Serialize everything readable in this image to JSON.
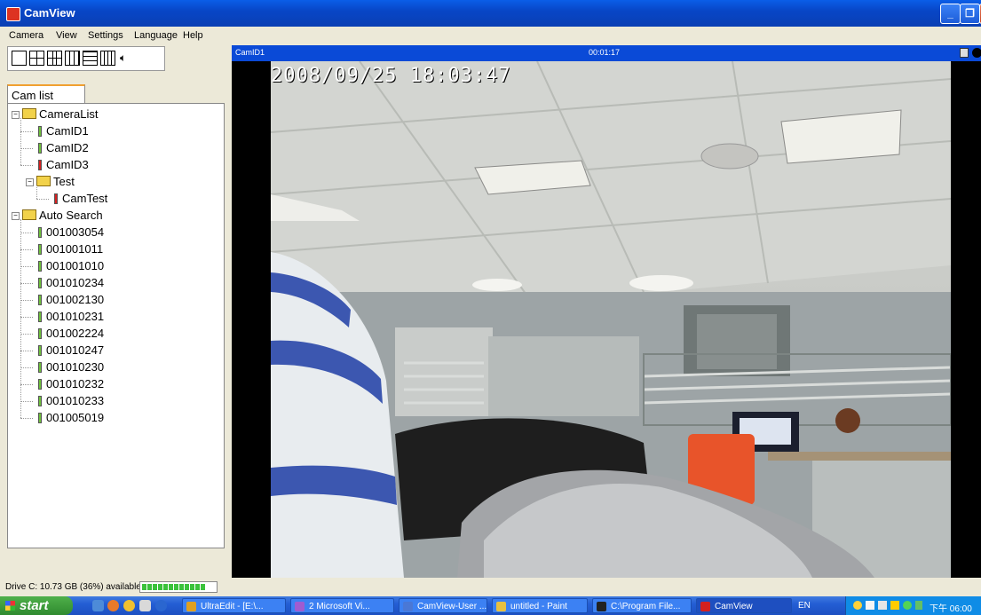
{
  "window": {
    "title": "CamView"
  },
  "menu": [
    "Camera",
    "View",
    "Settings",
    "Language",
    "Help"
  ],
  "sidebar": {
    "tab_label": "Cam list",
    "tree": [
      {
        "label": "CameraList",
        "kind": "folder",
        "children": [
          {
            "label": "CamID1",
            "status": "green"
          },
          {
            "label": "CamID2",
            "status": "green"
          },
          {
            "label": "CamID3",
            "status": "red"
          }
        ]
      },
      {
        "label": "Test",
        "kind": "folder",
        "children": [
          {
            "label": "CamTest",
            "status": "red"
          }
        ]
      },
      {
        "label": "Auto Search",
        "kind": "folder",
        "children": [
          {
            "label": "001003054",
            "status": "green"
          },
          {
            "label": "001001011",
            "status": "green"
          },
          {
            "label": "001001010",
            "status": "green"
          },
          {
            "label": "001010234",
            "status": "green"
          },
          {
            "label": "001002130",
            "status": "green"
          },
          {
            "label": "001010231",
            "status": "green"
          },
          {
            "label": "001002224",
            "status": "green"
          },
          {
            "label": "001010247",
            "status": "green"
          },
          {
            "label": "001010230",
            "status": "green"
          },
          {
            "label": "001010232",
            "status": "green"
          },
          {
            "label": "001010233",
            "status": "green"
          },
          {
            "label": "001005019",
            "status": "green"
          }
        ]
      }
    ]
  },
  "viewer": {
    "camera_name": "CamID1",
    "elapsed": "00:01:17",
    "overlay_timestamp": "2008/09/25 18:03:47"
  },
  "status": {
    "drive_text": "Drive C: 10.73 GB (36%) available",
    "drive_free_fraction": 0.36
  },
  "taskbar": {
    "start_label": "start",
    "tasks": [
      {
        "label": "UltraEdit - [E:\\...",
        "icon_color": "#e0a020"
      },
      {
        "label": "2 Microsoft Vi...",
        "icon_color": "#a05cd0"
      },
      {
        "label": "CamView-User ...",
        "icon_color": "#4a78d6"
      },
      {
        "label": "untitled - Paint",
        "icon_color": "#e8c040"
      },
      {
        "label": "C:\\Program File...",
        "icon_color": "#222222"
      },
      {
        "label": "CamView",
        "icon_color": "#d32020",
        "active": true
      }
    ],
    "language": "EN",
    "clock": "下午 06:00"
  }
}
